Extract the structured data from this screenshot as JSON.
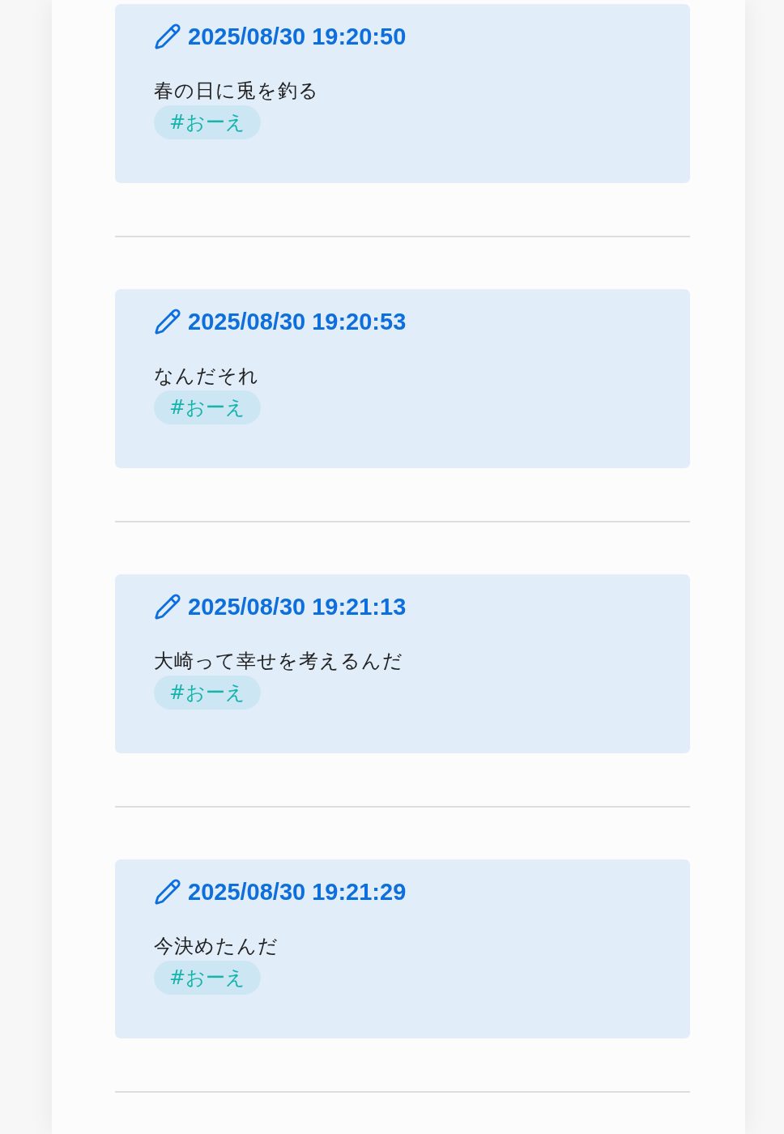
{
  "posts": [
    {
      "timestamp": "2025/08/30 19:20:50",
      "text": "春の日に兎を釣る",
      "tags": [
        "#おーえ"
      ]
    },
    {
      "timestamp": "2025/08/30 19:20:53",
      "text": "なんだそれ",
      "tags": [
        "#おーえ"
      ]
    },
    {
      "timestamp": "2025/08/30 19:21:13",
      "text": "大崎って幸せを考えるんだ",
      "tags": [
        "#おーえ"
      ]
    },
    {
      "timestamp": "2025/08/30 19:21:29",
      "text": "今決めたんだ",
      "tags": [
        "#おーえ"
      ]
    }
  ]
}
